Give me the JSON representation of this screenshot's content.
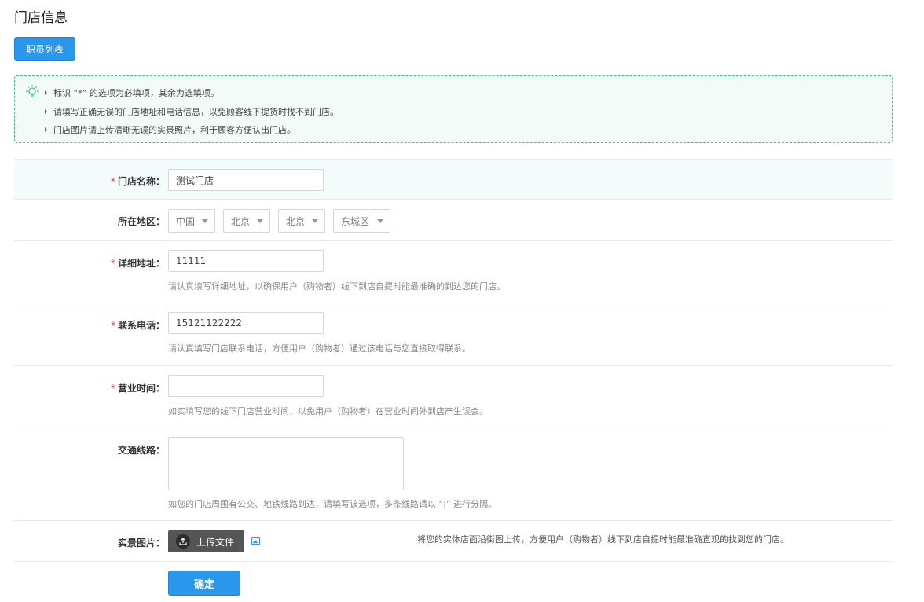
{
  "page": {
    "title": "门店信息"
  },
  "toolbar": {
    "staff_list_label": "职员列表"
  },
  "tips": {
    "lines": [
      "标识 “*” 的选项为必填项，其余为选填项。",
      "请填写正确无误的门店地址和电话信息，以免顾客线下提货时找不到门店。",
      "门店图片请上传清晰无误的实景照片，利于顾客方便认出门店。"
    ],
    "border_color": "#38c48a"
  },
  "form": {
    "required_mark": "*",
    "store_name": {
      "label": "门店名称：",
      "value": "测试门店"
    },
    "region": {
      "label": "所在地区：",
      "country": "中国",
      "province": "北京",
      "city": "北京",
      "district": "东城区"
    },
    "address": {
      "label": "详细地址：",
      "value": "11111",
      "hint": "请认真填写详细地址，以确保用户（购物者）线下到店自提时能最准确的到达您的门店。"
    },
    "phone": {
      "label": "联系电话：",
      "value": "15121122222",
      "hint": "请认真填写门店联系电话，方便用户（购物者）通过该电话与您直接取得联系。"
    },
    "hours": {
      "label": "营业时间：",
      "value": "",
      "hint": "如实填写您的线下门店营业时间，以免用户（购物者）在营业时间外到店产生误会。"
    },
    "transit": {
      "label": "交通线路：",
      "value": "",
      "hint": "如您的门店周围有公交、地铁线路到达，请填写该选项，多条线路请以 “|” 进行分隔。"
    },
    "photo": {
      "label": "实景图片：",
      "upload_label": "上传文件",
      "hint": "将您的实体店面沿街图上传，方便用户（购物者）线下到店自提时能最准确直观的找到您的门店。"
    },
    "submit_label": "确定"
  },
  "colors": {
    "primary": "#2a96ec",
    "required": "#e23a3a",
    "upload_bg": "#555555"
  },
  "icons": {
    "tips": "lightbulb-icon",
    "upload": "upload-icon",
    "image": "image-icon",
    "select": "caret-down-icon"
  }
}
